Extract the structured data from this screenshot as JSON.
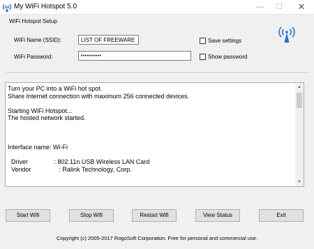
{
  "window": {
    "title": "My WiFi Hotspot 5.0",
    "controls": {
      "minimize": "—",
      "maximize": "☐",
      "close": "✕"
    }
  },
  "setup": {
    "section_title": "WiFi Hotspot Setup",
    "ssid_label": "WiFi Name (SSID):",
    "ssid_value": "LIST OF FREEWARE",
    "password_label": "WiFi Password:",
    "password_value": "••••••••••",
    "save_settings_label": "Save settings",
    "save_settings_checked": false,
    "show_password_label": "Show password",
    "show_password_checked": false
  },
  "log": {
    "text": "Turn your PC into a WiFi hot spot.\nShare Internet connection with maximum 256 connected devices.\n\nStarting WiFi Hotspot...\nThe hosted network started.\n\n\n\nInterface name: Wi-Fi\n\n  Driver               : 802.11n USB Wireless LAN Card\n  Vendor                : Ralink Technology, Corp."
  },
  "buttons": {
    "start": "Start Wifi",
    "stop": "Stop Wifi",
    "restart": "Restart Wifi",
    "view_status": "View Status",
    "exit": "Exit"
  },
  "footer": {
    "copyright": "Copyright (c)  2005-2017 RogoSoft Corporation. Free for personal and commercial use."
  },
  "colors": {
    "accent_icon": "#1e6fd9",
    "window_bg": "#f0f0f0",
    "button_bg": "#e1e1e1"
  },
  "icons": {
    "app": "wifi-antenna-icon",
    "header": "wifi-broadcast-icon"
  }
}
